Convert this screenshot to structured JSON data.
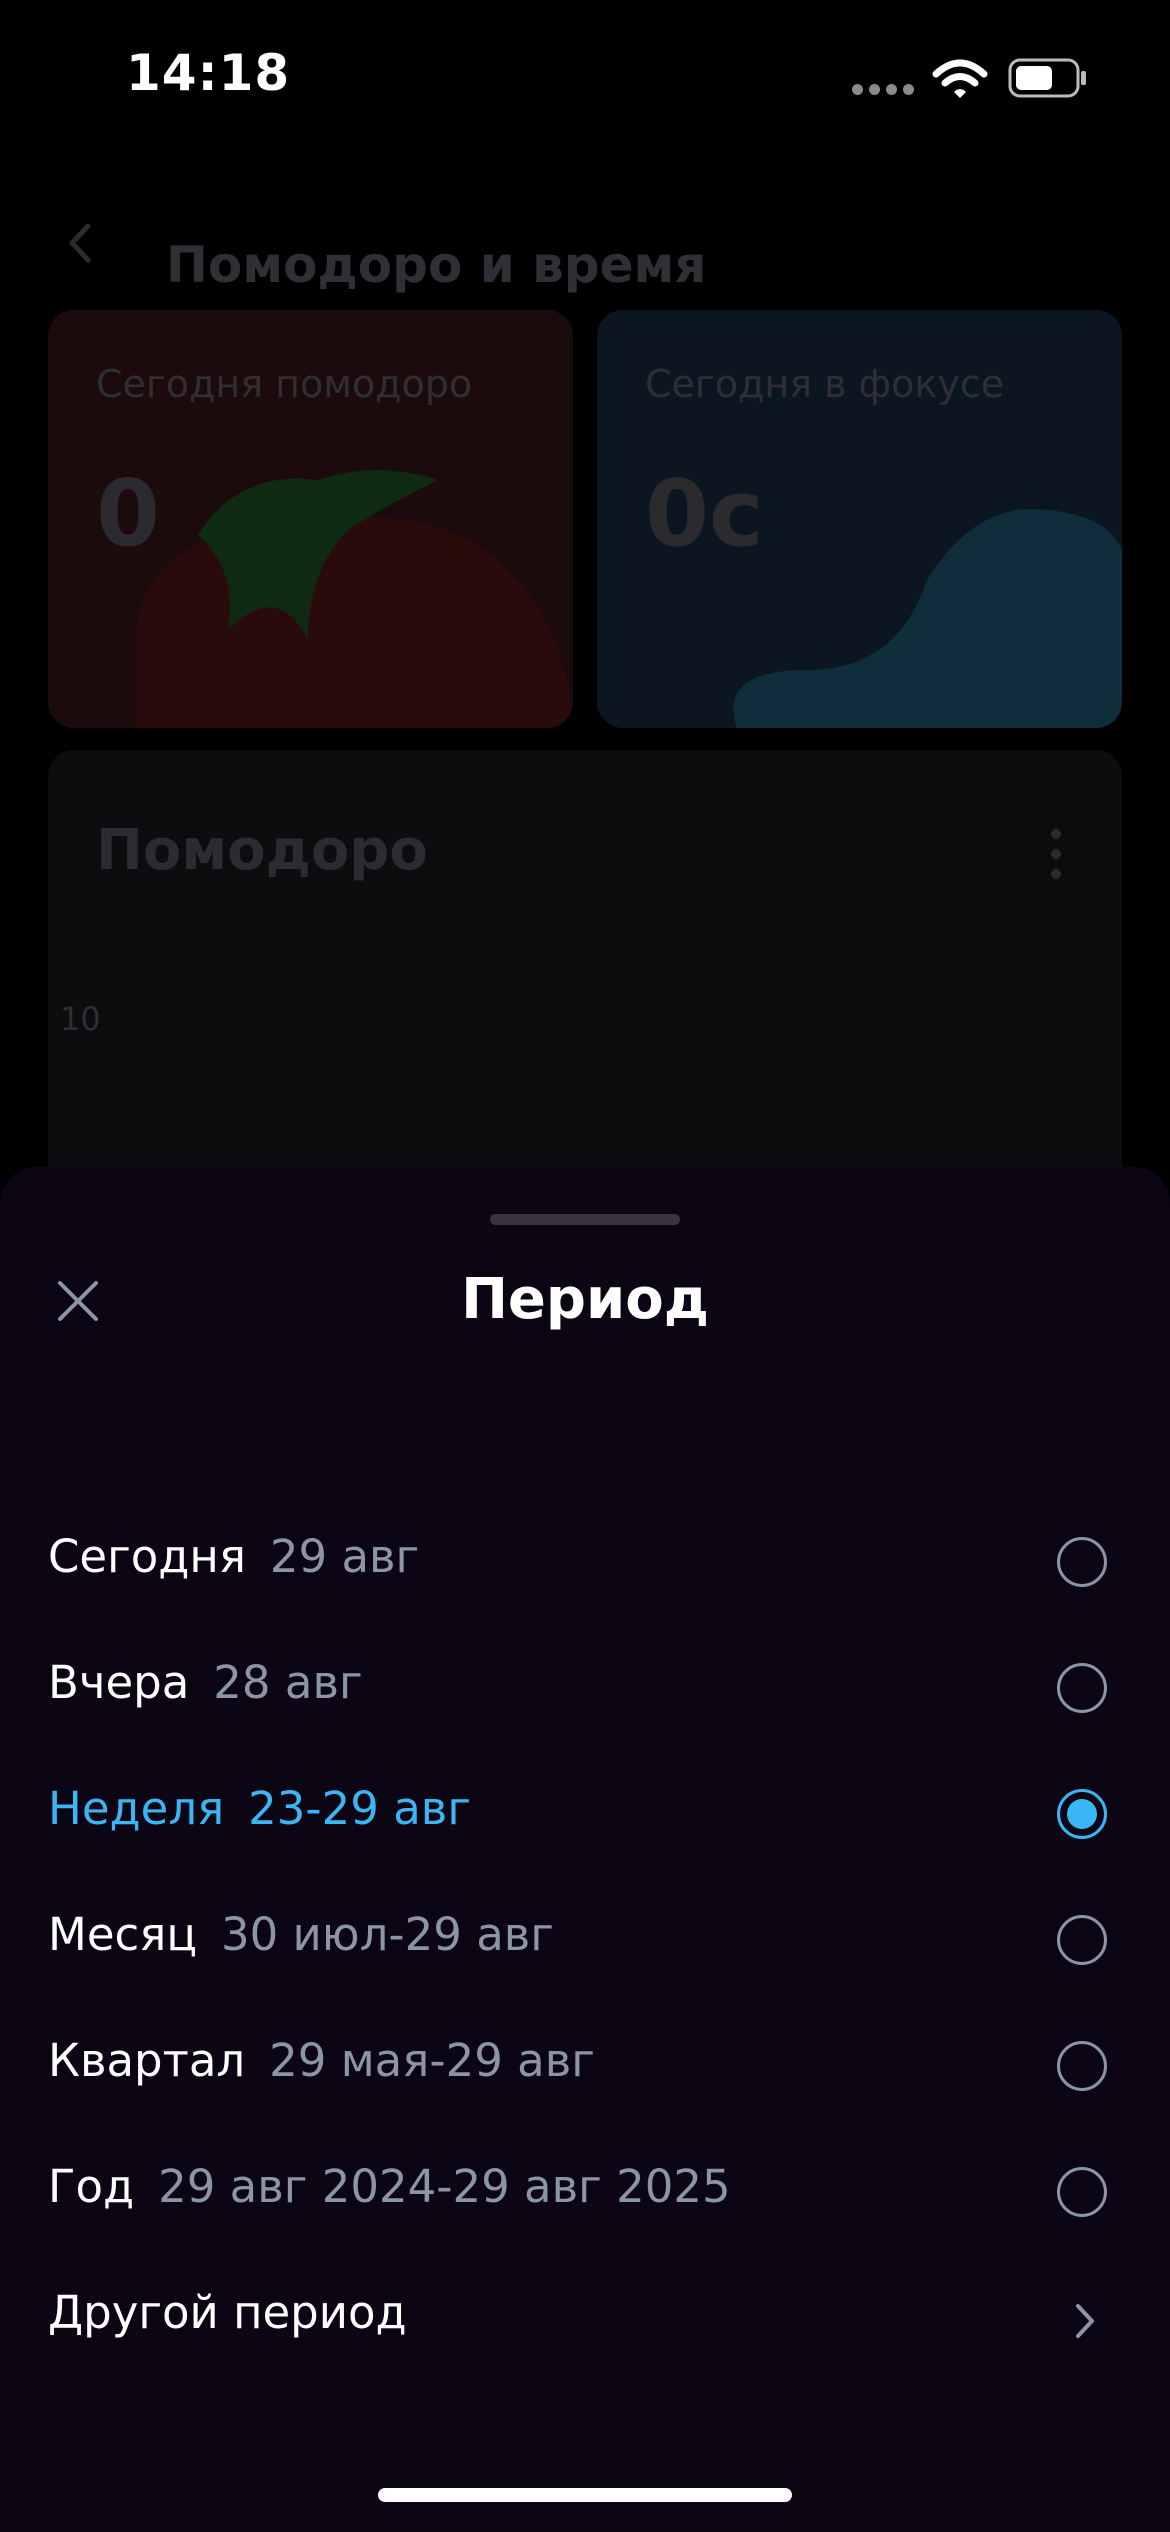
{
  "status_bar": {
    "time": "14:18",
    "icons": [
      "signal-dots-icon",
      "wifi-icon",
      "battery-icon"
    ]
  },
  "background_page": {
    "title": "Помодоро и время",
    "cards": [
      {
        "label": "Сегодня помодоро",
        "value": "0",
        "art": "tomato"
      },
      {
        "label": "Сегодня в фокусе",
        "value": "0с",
        "art": "wave"
      }
    ],
    "chart": {
      "title": "Помодоро",
      "tick_label": "10"
    }
  },
  "sheet": {
    "title": "Период",
    "options": [
      {
        "name": "Сегодня",
        "range": "29 авг",
        "selected": false
      },
      {
        "name": "Вчера",
        "range": "28 авг",
        "selected": false
      },
      {
        "name": "Неделя",
        "range": "23-29 авг",
        "selected": true
      },
      {
        "name": "Месяц",
        "range": "30 июл-29 авг",
        "selected": false
      },
      {
        "name": "Квартал",
        "range": "29 мая-29 авг",
        "selected": false
      },
      {
        "name": "Год",
        "range": "29 авг 2024-29 авг 2025",
        "selected": false
      }
    ],
    "custom_period": "Другой период"
  },
  "colors": {
    "accent": "#3ab6f5",
    "sheet_background": "#0b0514",
    "secondary_text": "#8b95a6"
  }
}
